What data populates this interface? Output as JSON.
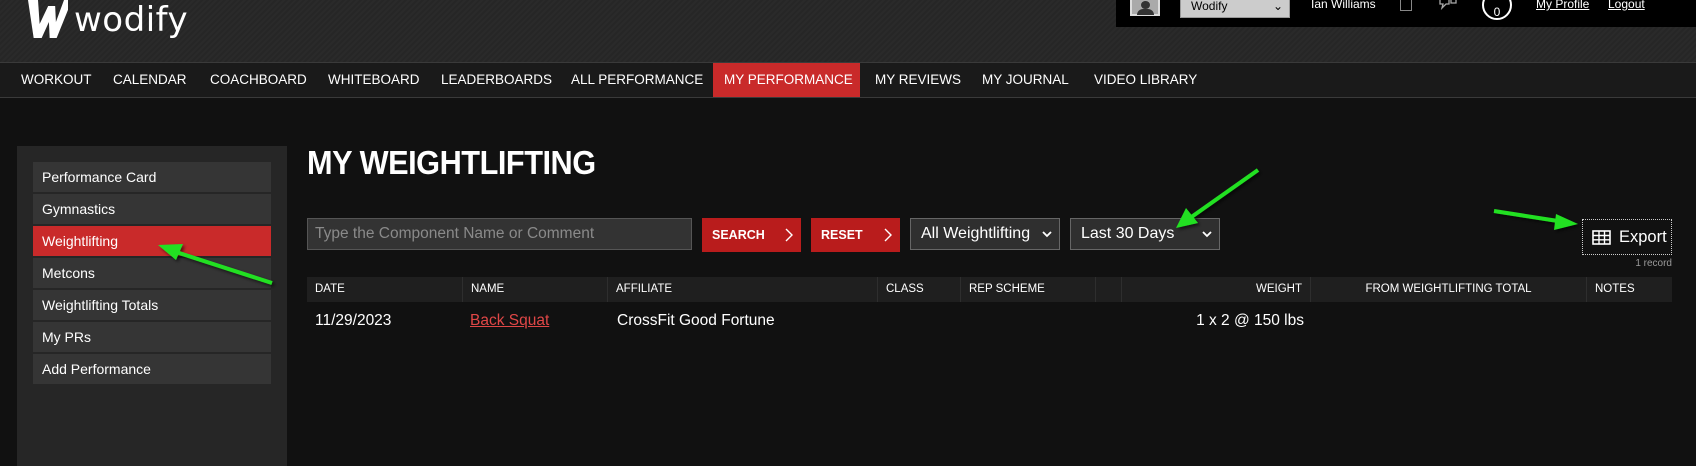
{
  "brand": {
    "name": "wodify"
  },
  "topbar": {
    "gym_select_value": "Wodify",
    "user_name": "Ian Williams",
    "notification_count": "0",
    "my_profile_label": "My Profile",
    "logout_label": "Logout"
  },
  "nav": {
    "items": [
      {
        "label": "WORKOUT"
      },
      {
        "label": "CALENDAR"
      },
      {
        "label": "COACHBOARD"
      },
      {
        "label": "WHITEBOARD"
      },
      {
        "label": "LEADERBOARDS"
      },
      {
        "label": "ALL PERFORMANCE"
      },
      {
        "label": "MY PERFORMANCE"
      },
      {
        "label": "MY REVIEWS"
      },
      {
        "label": "MY JOURNAL"
      },
      {
        "label": "VIDEO LIBRARY"
      }
    ],
    "active": "MY PERFORMANCE"
  },
  "sidebar": {
    "items": [
      {
        "label": "Performance Card"
      },
      {
        "label": "Gymnastics"
      },
      {
        "label": "Weightlifting"
      },
      {
        "label": "Metcons"
      },
      {
        "label": "Weightlifting Totals"
      },
      {
        "label": "My PRs"
      },
      {
        "label": "Add Performance"
      }
    ],
    "active": "Weightlifting"
  },
  "main": {
    "title": "MY WEIGHTLIFTING",
    "search_placeholder": "Type the Component Name or Comment",
    "search_label": "SEARCH",
    "reset_label": "RESET",
    "type_filter": "All Weightlifting",
    "date_filter": "Last 30 Days",
    "export_label": "Export",
    "record_count": "1 record"
  },
  "table": {
    "headers": [
      "DATE",
      "NAME",
      "AFFILIATE",
      "CLASS",
      "REP SCHEME",
      "",
      "WEIGHT",
      "FROM WEIGHTLIFTING TOTAL",
      "NOTES"
    ],
    "rows": [
      {
        "date": "11/29/2023",
        "name": "Back Squat",
        "affiliate": "CrossFit Good Fortune",
        "class": "",
        "rep_scheme": "",
        "weight": "1 x 2 @ 150 lbs",
        "from_total": "",
        "notes": ""
      }
    ]
  },
  "colors": {
    "accent_red": "#c92a2a",
    "background": "#111111",
    "annotation_arrow": "#22e022"
  }
}
